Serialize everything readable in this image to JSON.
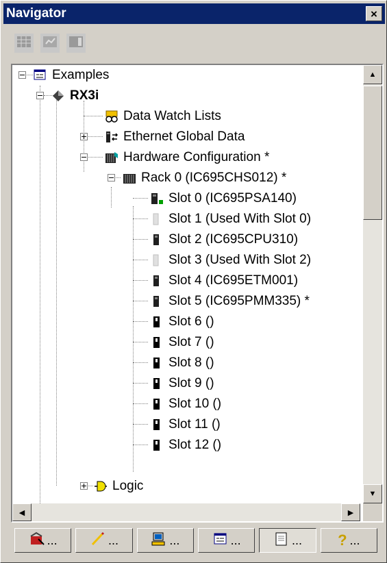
{
  "window": {
    "title": "Navigator",
    "close_glyph": "×"
  },
  "toolbar": {
    "buttons": [
      {
        "icon": "table-view-icon"
      },
      {
        "icon": "ladder-view-icon"
      },
      {
        "icon": "grid-view-icon"
      }
    ]
  },
  "tree": {
    "root": "Examples",
    "target": "RX3i",
    "data_watch": "Data Watch Lists",
    "egd": "Ethernet Global Data",
    "hwconfig": "Hardware Configuration *",
    "rack": "Rack 0 (IC695CHS012) *",
    "slots": [
      "Slot 0 (IC695PSA140)",
      "Slot 1 (Used With Slot 0)",
      "Slot 2 (IC695CPU310)",
      "Slot 3 (Used With Slot 2)",
      "Slot 4 (IC695ETM001)",
      "Slot 5 (IC695PMM335) *",
      "Slot 6 ()",
      "Slot 7 ()",
      "Slot 8 ()",
      "Slot 9 ()",
      "Slot 10 ()",
      "Slot 11 ()",
      "Slot 12 ()"
    ],
    "logic": "Logic"
  },
  "tabs": [
    {
      "icon": "toolchest-icon",
      "label": "..."
    },
    {
      "icon": "pencil-icon",
      "label": "..."
    },
    {
      "icon": "computer-icon",
      "label": "..."
    },
    {
      "icon": "project-icon",
      "label": "..."
    },
    {
      "icon": "scroll-icon",
      "label": "..."
    },
    {
      "icon": "help-icon",
      "label": "...",
      "glyph": "?"
    }
  ]
}
